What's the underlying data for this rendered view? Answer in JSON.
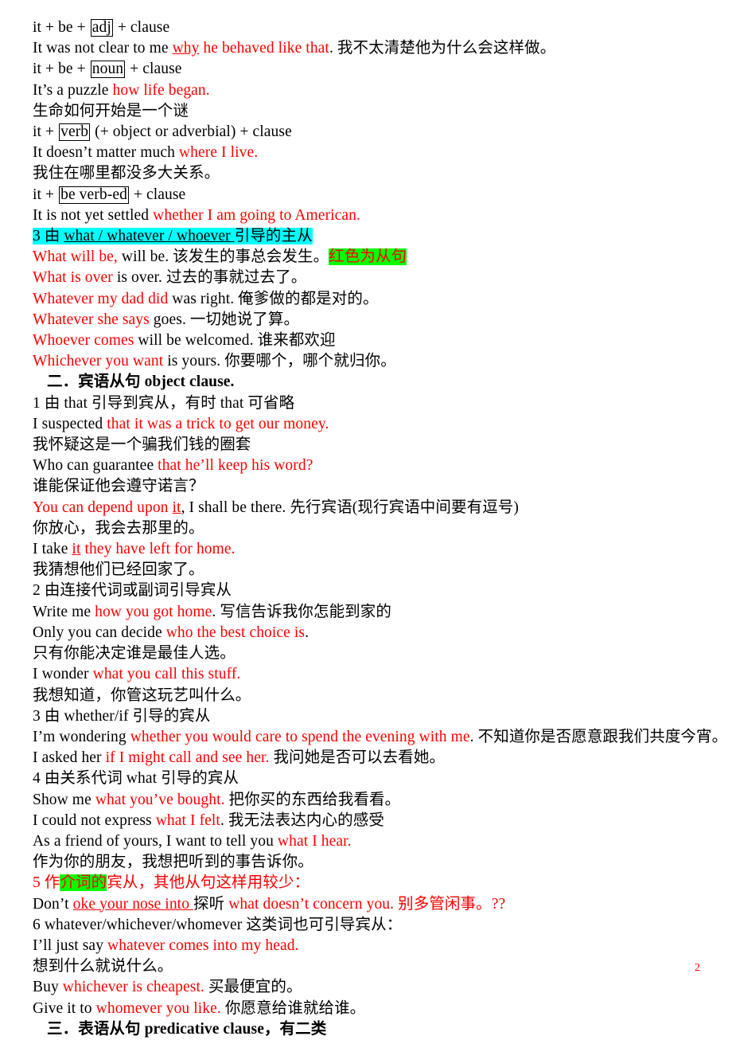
{
  "document": {
    "page_number": "2",
    "page_number_color": "#ff0000",
    "highlight_colors": {
      "cyan": "#00ffff",
      "green": "#00ff00"
    },
    "text_colors": {
      "body": "#000000",
      "clause": "#ff0000"
    }
  },
  "lines": [
    {
      "id": "l1",
      "segments": [
        {
          "t": "it + be + ",
          "c": "black"
        },
        {
          "t": "adj",
          "c": "black",
          "box": true
        },
        {
          "t": " + clause",
          "c": "black"
        }
      ]
    },
    {
      "id": "l2",
      "segments": [
        {
          "t": "It was not clear to me",
          "c": "black"
        },
        {
          "t": "   ",
          "c": "black"
        },
        {
          "t": "why",
          "c": "red",
          "u": true
        },
        {
          "t": " he behaved like that",
          "c": "red"
        },
        {
          "t": ". 我不太清楚他为什么会这样做。",
          "c": "black"
        }
      ]
    },
    {
      "id": "l3",
      "segments": [
        {
          "t": "it + be + ",
          "c": "black"
        },
        {
          "t": "noun",
          "c": "black",
          "box": true
        },
        {
          "t": " + clause",
          "c": "black"
        }
      ]
    },
    {
      "id": "l4",
      "segments": [
        {
          "t": "It’s a puzzle",
          "c": "black"
        },
        {
          "t": "    ",
          "c": "black"
        },
        {
          "t": "how life began.",
          "c": "red"
        }
      ]
    },
    {
      "id": "l5",
      "segments": [
        {
          "t": "生命如何开始是一个谜",
          "c": "black"
        }
      ]
    },
    {
      "id": "l6",
      "segments": [
        {
          "t": "it + ",
          "c": "black"
        },
        {
          "t": "verb",
          "c": "black",
          "box": true
        },
        {
          "t": " (+ object or adverbial) + clause",
          "c": "black"
        }
      ]
    },
    {
      "id": "l7",
      "segments": [
        {
          "t": "It doesn’t matter much",
          "c": "black"
        },
        {
          "t": "    ",
          "c": "black"
        },
        {
          "t": "where I live.",
          "c": "red"
        }
      ]
    },
    {
      "id": "l8",
      "segments": [
        {
          "t": "我住在哪里都没多大关系。",
          "c": "black"
        }
      ]
    },
    {
      "id": "l9",
      "segments": [
        {
          "t": "it + ",
          "c": "black"
        },
        {
          "t": "be verb-ed",
          "c": "black",
          "box": true
        },
        {
          "t": " + clause",
          "c": "black"
        }
      ]
    },
    {
      "id": "l10",
      "segments": [
        {
          "t": "It is not yet settled",
          "c": "black"
        },
        {
          "t": "    ",
          "c": "black"
        },
        {
          "t": "whether I am going to American.",
          "c": "red"
        }
      ]
    },
    {
      "id": "l11",
      "segments": [
        {
          "t": "3 由 ",
          "c": "black",
          "hl": "cyan"
        },
        {
          "t": "what / whatever / whoever ",
          "c": "black",
          "hl": "cyan",
          "u": true
        },
        {
          "t": "引导的主从",
          "c": "black",
          "hl": "cyan"
        }
      ]
    },
    {
      "id": "l12",
      "segments": [
        {
          "t": "What will be,",
          "c": "red"
        },
        {
          "t": "   ",
          "c": "black"
        },
        {
          "t": "will be.",
          "c": "black"
        },
        {
          "t": "  该发生的事总会发生。",
          "c": "black"
        },
        {
          "t": "红色为从句",
          "c": "red",
          "hl": "green"
        }
      ]
    },
    {
      "id": "l13",
      "segments": [
        {
          "t": "What is over",
          "c": "red"
        },
        {
          "t": "   ",
          "c": "black"
        },
        {
          "t": "is over.",
          "c": "black"
        },
        {
          "t": "   过去的事就过去了。",
          "c": "black"
        }
      ]
    },
    {
      "id": "l14",
      "segments": [
        {
          "t": "Whatever my dad did",
          "c": "red"
        },
        {
          "t": "   ",
          "c": "black"
        },
        {
          "t": "was right.",
          "c": "black"
        },
        {
          "t": "  俺爹做的都是对的。",
          "c": "black"
        }
      ]
    },
    {
      "id": "l15",
      "segments": [
        {
          "t": "Whatever she says",
          "c": "red"
        },
        {
          "t": "   ",
          "c": "black"
        },
        {
          "t": "goes.",
          "c": "black"
        },
        {
          "t": "  一切她说了算。",
          "c": "black"
        }
      ]
    },
    {
      "id": "l16",
      "segments": [
        {
          "t": "Whoever comes",
          "c": "red"
        },
        {
          "t": " will be welcomed.",
          "c": "black"
        },
        {
          "t": "  谁来都欢迎",
          "c": "black"
        }
      ]
    },
    {
      "id": "l17",
      "segments": [
        {
          "t": "Whichever you want",
          "c": "red"
        },
        {
          "t": " is yours.",
          "c": "black"
        },
        {
          "t": "  你要哪个，哪个就归你。",
          "c": "black"
        }
      ]
    },
    {
      "id": "l18",
      "segments": [
        {
          "t": "二．宾语从句 object clause.",
          "c": "black",
          "b": true
        }
      ],
      "indent": "hd"
    },
    {
      "id": "l19",
      "segments": [
        {
          "t": "1 由 that 引导到宾从，有时 that 可省略",
          "c": "black"
        }
      ]
    },
    {
      "id": "l20",
      "segments": [
        {
          "t": "I suspected ",
          "c": "black"
        },
        {
          "t": "that it was a trick to get our money.",
          "c": "red"
        }
      ]
    },
    {
      "id": "l21",
      "segments": [
        {
          "t": "我怀疑这是一个骗我们钱的圈套",
          "c": "black"
        }
      ]
    },
    {
      "id": "l22",
      "segments": [
        {
          "t": "Who can guarantee ",
          "c": "black"
        },
        {
          "t": "that he’ll keep his word?",
          "c": "red"
        }
      ]
    },
    {
      "id": "l23",
      "segments": [
        {
          "t": "谁能保证他会遵守诺言？",
          "c": "black"
        }
      ]
    },
    {
      "id": "l24",
      "segments": [
        {
          "t": "You can depend upon ",
          "c": "red"
        },
        {
          "t": "it",
          "c": "red",
          "u": true
        },
        {
          "t": ", I shall be there.",
          "c": "black"
        },
        {
          "t": "  先行宾语(现行宾语中间要有逗号)",
          "c": "black"
        }
      ]
    },
    {
      "id": "l25",
      "segments": [
        {
          "t": "你放心，我会去那里的。",
          "c": "black"
        }
      ]
    },
    {
      "id": "l26",
      "segments": [
        {
          "t": "I take ",
          "c": "black"
        },
        {
          "t": "it",
          "c": "red",
          "u": true
        },
        {
          "t": " they have left for home.",
          "c": "red"
        }
      ]
    },
    {
      "id": "l27",
      "segments": [
        {
          "t": "我猜想他们已经回家了。",
          "c": "black"
        }
      ]
    },
    {
      "id": "l28",
      "segments": [
        {
          "t": "2 由连接代词或副词引导宾从",
          "c": "black"
        }
      ]
    },
    {
      "id": "l29",
      "segments": [
        {
          "t": "Write me ",
          "c": "black"
        },
        {
          "t": "how you got home",
          "c": "red"
        },
        {
          "t": ".",
          "c": "black"
        },
        {
          "t": "  写信告诉我你怎能到家的",
          "c": "black"
        }
      ]
    },
    {
      "id": "l30",
      "segments": [
        {
          "t": "Only you can decide",
          "c": "black"
        },
        {
          "t": "    ",
          "c": "black"
        },
        {
          "t": "who the best choice is",
          "c": "red"
        },
        {
          "t": ".",
          "c": "black"
        }
      ]
    },
    {
      "id": "l31",
      "segments": [
        {
          "t": "只有你能决定谁是最佳人选。",
          "c": "black"
        }
      ]
    },
    {
      "id": "l32",
      "segments": [
        {
          "t": "I wonder",
          "c": "black"
        },
        {
          "t": "    ",
          "c": "black"
        },
        {
          "t": "what you call this stuff.",
          "c": "red"
        }
      ]
    },
    {
      "id": "l33",
      "segments": [
        {
          "t": "我想知道，你管这玩艺叫什么。",
          "c": "black"
        }
      ]
    },
    {
      "id": "l34",
      "segments": [
        {
          "t": "3 由 whether/if 引导的宾从",
          "c": "black"
        }
      ]
    },
    {
      "id": "l35",
      "segments": [
        {
          "t": "I’m wondering ",
          "c": "black"
        },
        {
          "t": "whether you would care to spend the evening with me",
          "c": "red"
        },
        {
          "t": ".",
          "c": "black"
        },
        {
          "t": "  不知道你是否愿意跟我们共度今宵。",
          "c": "black"
        }
      ]
    },
    {
      "id": "l36",
      "segments": [
        {
          "t": "I asked her ",
          "c": "black"
        },
        {
          "t": "if I might call and see her.",
          "c": "red"
        },
        {
          "t": "  我问她是否可以去看她。",
          "c": "black"
        }
      ]
    },
    {
      "id": "l37",
      "segments": [
        {
          "t": "4 由关系代词 what 引导的宾从",
          "c": "black"
        }
      ]
    },
    {
      "id": "l38",
      "segments": [
        {
          "t": "Show me ",
          "c": "black"
        },
        {
          "t": "what you’ve bought.",
          "c": "red"
        },
        {
          "t": "  把你买的东西给我看看。",
          "c": "black"
        }
      ]
    },
    {
      "id": "l39",
      "segments": [
        {
          "t": "I could not express ",
          "c": "black"
        },
        {
          "t": "what I felt",
          "c": "red"
        },
        {
          "t": ".",
          "c": "black"
        },
        {
          "t": "  我无法表达内心的感受",
          "c": "black"
        }
      ]
    },
    {
      "id": "l40",
      "segments": [
        {
          "t": "As a friend of yours, I want to tell you ",
          "c": "black"
        },
        {
          "t": "what I hear.",
          "c": "red"
        }
      ]
    },
    {
      "id": "l41",
      "segments": [
        {
          "t": "作为你的朋友，我想把听到的事告诉你。",
          "c": "black"
        }
      ]
    },
    {
      "id": "l42",
      "segments": [
        {
          "t": "5 作",
          "c": "red"
        },
        {
          "t": "介词的",
          "c": "red",
          "hl": "green"
        },
        {
          "t": "宾从，其他从句这样用较少：",
          "c": "red"
        }
      ]
    },
    {
      "id": "l43",
      "segments": [
        {
          "t": "Don’t",
          "c": "black"
        },
        {
          "t": "   ",
          "c": "black"
        },
        {
          "t": "oke your nose into ",
          "c": "red",
          "u": true
        },
        {
          "t": "探听",
          "c": "black"
        },
        {
          "t": " what doesn’t concern you.",
          "c": "red"
        },
        {
          "t": "  别多管闲事。??",
          "c": "red"
        }
      ]
    },
    {
      "id": "l44",
      "segments": [
        {
          "t": "6",
          "c": "black"
        },
        {
          "t": "    ",
          "c": "black"
        },
        {
          "t": "whatever/whichever/whomever 这类词也可引导宾从：",
          "c": "black"
        }
      ]
    },
    {
      "id": "l45",
      "segments": [
        {
          "t": "I’ll just say ",
          "c": "black"
        },
        {
          "t": "whatever comes into my head.",
          "c": "red"
        }
      ]
    },
    {
      "id": "l46",
      "segments": [
        {
          "t": "想到什么就说什么。",
          "c": "black"
        }
      ]
    },
    {
      "id": "l47",
      "segments": [
        {
          "t": "Buy",
          "c": "black"
        },
        {
          "t": "    ",
          "c": "black"
        },
        {
          "t": "whichever is cheapest.",
          "c": "red"
        },
        {
          "t": "  买最便宜的。",
          "c": "black"
        }
      ]
    },
    {
      "id": "l48",
      "segments": [
        {
          "t": "Give it to",
          "c": "black"
        },
        {
          "t": "    ",
          "c": "black"
        },
        {
          "t": "whomever you like.",
          "c": "red"
        },
        {
          "t": "  你愿意给谁就给谁。",
          "c": "black"
        }
      ]
    },
    {
      "id": "l49",
      "segments": [
        {
          "t": "三．表语从句 predicative clause，有二类",
          "c": "black",
          "b": true
        }
      ],
      "indent": "hd"
    }
  ]
}
